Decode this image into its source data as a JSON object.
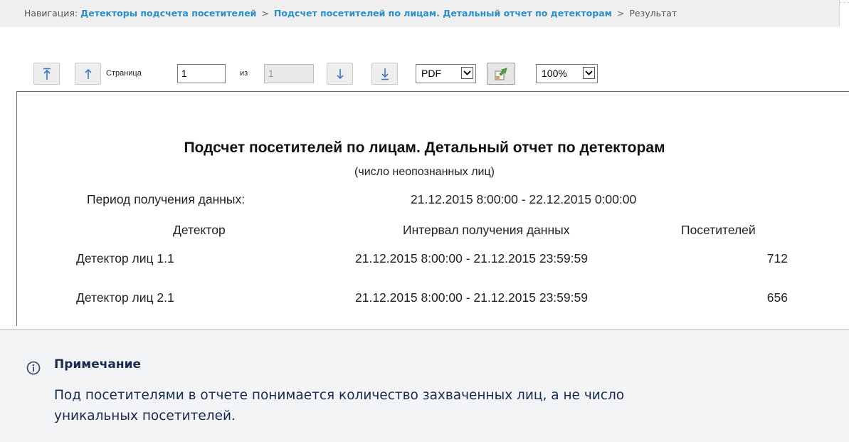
{
  "breadcrumb": {
    "prefix": "Навигация:",
    "items": [
      {
        "label": "Детекторы подсчета посетителей"
      },
      {
        "label": "Подсчет посетителей по лицам. Детальный отчет по детекторам"
      }
    ],
    "current": "Результат",
    "separator": ">"
  },
  "toolbar": {
    "page_label": "Страница",
    "page_value": "1",
    "of_label": "из",
    "total_pages": "1",
    "format_selected": "PDF",
    "zoom_selected": "100%"
  },
  "report": {
    "title": "Подсчет посетителей по лицам. Детальный отчет по детекторам",
    "subtitle": "(число неопознанных лиц)",
    "period_label": "Период получения данных:",
    "period_value": "21.12.2015 8:00:00 - 22.12.2015 0:00:00",
    "columns": [
      "Детектор",
      "Интервал получения данных",
      "Посетителей"
    ],
    "rows": [
      {
        "detector": "Детектор лиц 1.1",
        "interval": "21.12.2015 8:00:00 - 21.12.2015 23:59:59",
        "visitors": "712"
      },
      {
        "detector": "Детектор лиц 2.1",
        "interval": "21.12.2015 8:00:00 - 21.12.2015 23:59:59",
        "visitors": "656"
      }
    ]
  },
  "note": {
    "title": "Примечание",
    "body": "Под посетителями в отчете понимается количество захваченных лиц, а не число уникальных посетителей."
  },
  "colors": {
    "link": "#2a8fc7",
    "note_text": "#172b4d",
    "note_background": "#f3f4f5"
  }
}
